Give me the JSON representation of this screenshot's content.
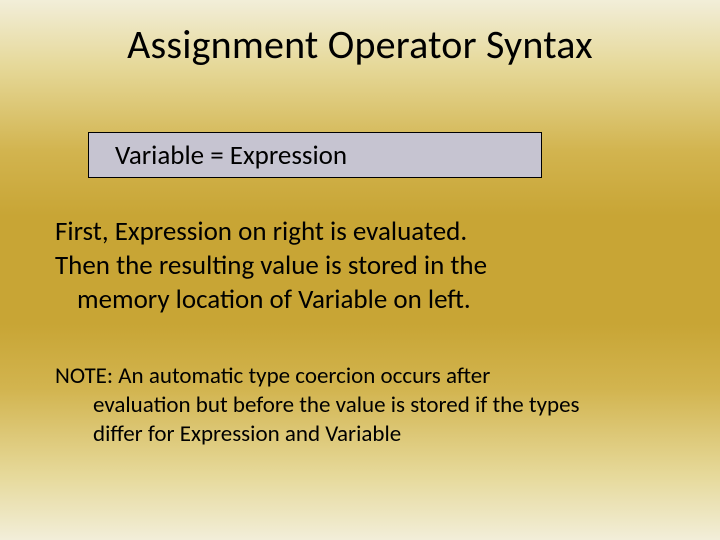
{
  "title": "Assignment Operator Syntax",
  "syntax": "Variable  =  Expression",
  "body": {
    "line1": "First, Expression on right is evaluated.",
    "line2": "Then the resulting value is stored in the",
    "line3": "memory location of Variable on left."
  },
  "note": {
    "line1": "NOTE:  An automatic type coercion occurs after",
    "line2": "evaluation but before the value is stored if the types",
    "line3": "differ for Expression and Variable"
  }
}
